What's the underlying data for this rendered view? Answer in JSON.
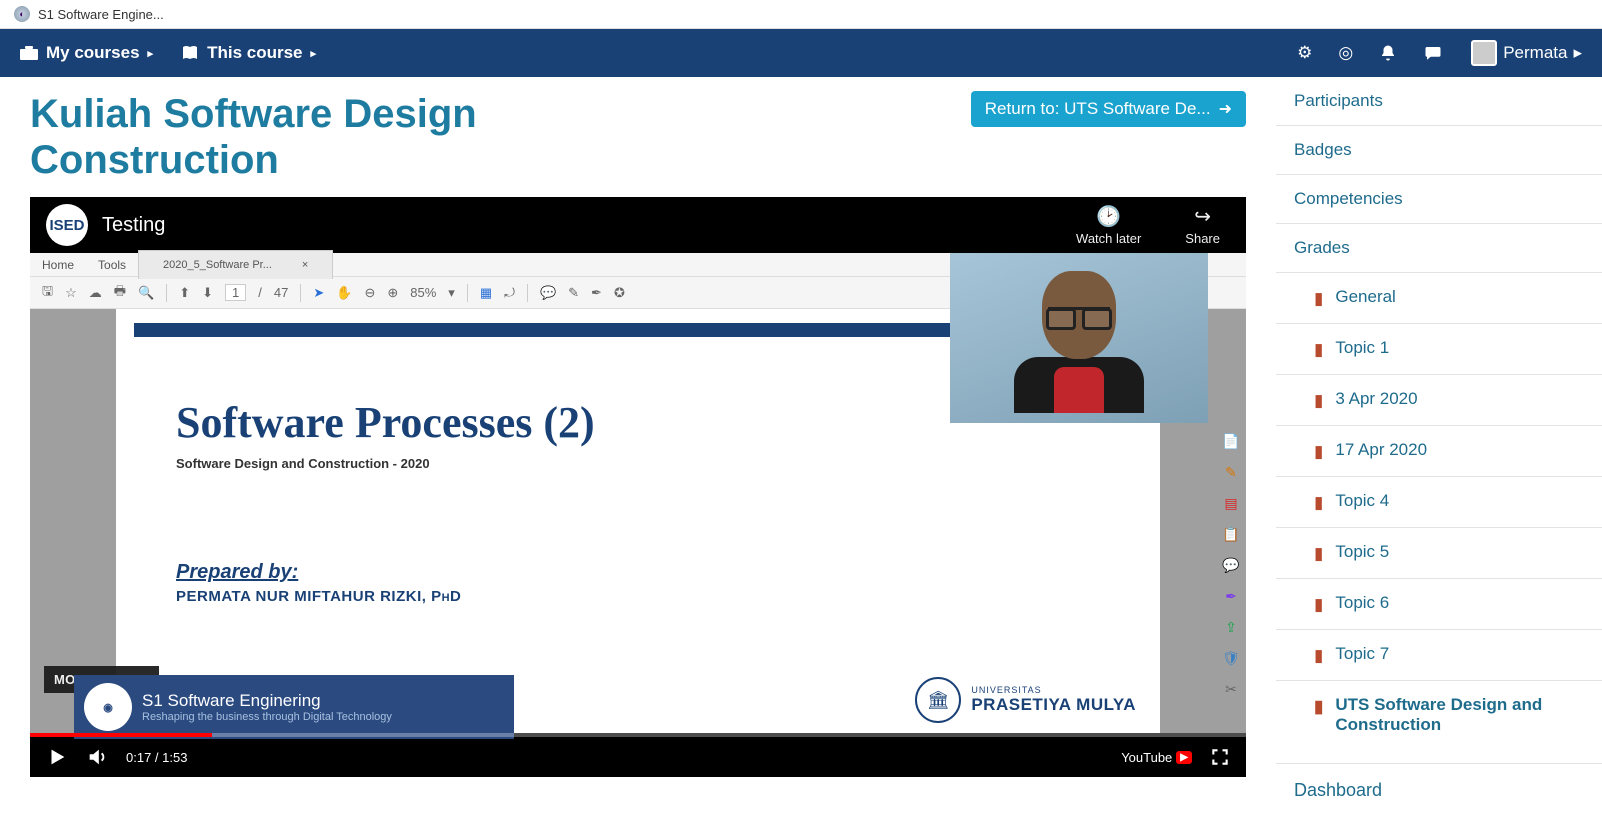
{
  "browser": {
    "tab_title": "S1 Software Engine..."
  },
  "nav": {
    "my_courses": "My courses",
    "this_course": "This course",
    "user_name": "Permata"
  },
  "page": {
    "title": "Kuliah Software Design Construction",
    "return_label": "Return to: UTS Software De..."
  },
  "video": {
    "channel_badge": "ISED",
    "video_title": "Testing",
    "watch_later": "Watch later",
    "share": "Share",
    "more_videos": "MORE VIDEOS",
    "suggested_title": "S1 Software Enginering",
    "suggested_sub": "Reshaping the business through Digital Technology",
    "time_current": "0:17",
    "time_total": "1:53",
    "youtube": "YouTube"
  },
  "pdf": {
    "menu_home": "Home",
    "menu_tools": "Tools",
    "tab_name": "2020_5_Software Pr...",
    "page_current": "1",
    "page_total": "47",
    "zoom": "85%"
  },
  "slide": {
    "title": "Software Processes (2)",
    "subtitle": "Software Design and Construction  -  2020",
    "prepared_label": "Prepared by:",
    "prepared_name": "PERMATA NUR MIFTAHUR RIZKI, PhD",
    "uni_small": "UNIVERSITAS",
    "uni_big": "PRASETIYA MULYA"
  },
  "sidebar": {
    "items": [
      "Participants",
      "Badges",
      "Competencies",
      "Grades"
    ],
    "folders": [
      "General",
      "Topic 1",
      "3 Apr 2020",
      "17 Apr 2020",
      "Topic 4",
      "Topic 5",
      "Topic 6",
      "Topic 7",
      "UTS Software Design and Construction"
    ],
    "dashboard": "Dashboard"
  }
}
